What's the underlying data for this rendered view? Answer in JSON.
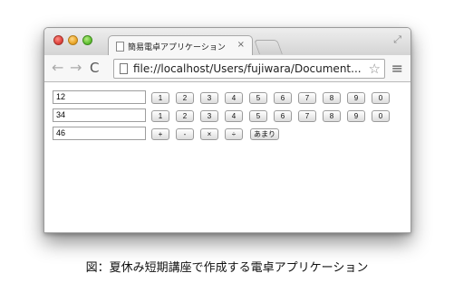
{
  "browser": {
    "tab_title": "簡易電卓アプリケーション",
    "tab_close": "×",
    "url": "file://localhost/Users/fujiwara/Document...",
    "back_icon": "←",
    "forward_icon": "→",
    "reload_icon": "C",
    "star_icon": "☆",
    "menu_icon": "≡",
    "fullscreen_icon": "⤢"
  },
  "calculator": {
    "input1_value": "12",
    "input2_value": "34",
    "result_value": "46",
    "digit_keys_row1": [
      "1",
      "2",
      "3",
      "4",
      "5",
      "6",
      "7",
      "8",
      "9",
      "0"
    ],
    "digit_keys_row2": [
      "1",
      "2",
      "3",
      "4",
      "5",
      "6",
      "7",
      "8",
      "9",
      "0"
    ],
    "operators": [
      "+",
      "-",
      "×",
      "÷",
      "あまり"
    ]
  },
  "caption": "図：夏休み短期講座で作成する電卓アプリケーション"
}
